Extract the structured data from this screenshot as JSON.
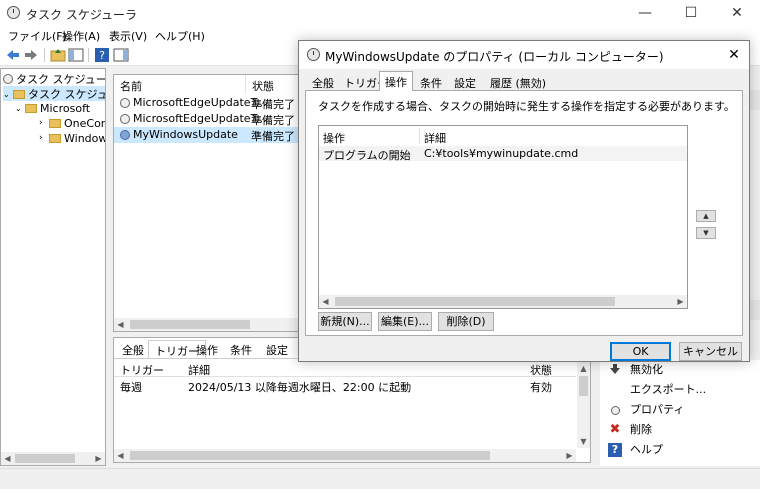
{
  "main_window": {
    "title": "タスク スケジューラ",
    "controls": {
      "minimize": "—",
      "maximize": "☐",
      "close": "✕"
    }
  },
  "menu": [
    "ファイル(F)",
    "操作(A)",
    "表示(V)",
    "ヘルプ(H)"
  ],
  "tree": {
    "root": "タスク スケジューラ (ロ",
    "library": "タスク スケジューラ ラ",
    "microsoft": "Microsoft",
    "children": [
      "OneCore",
      "Windows"
    ]
  },
  "task_list": {
    "headers": {
      "name": "名前",
      "status": "状態"
    },
    "rows": [
      {
        "name": "MicrosoftEdgeUpdateT...",
        "status": "準備完了"
      },
      {
        "name": "MicrosoftEdgeUpdateT...",
        "status": "準備完了"
      },
      {
        "name": "MyWindowsUpdate",
        "status": "準備完了"
      }
    ]
  },
  "detail": {
    "tabs": [
      "全般",
      "トリガー",
      "操作",
      "条件",
      "設定"
    ],
    "active_tab": "トリガー",
    "headers": {
      "trigger": "トリガー",
      "detail": "詳細",
      "status": "状態"
    },
    "rows": [
      {
        "trigger": "毎週",
        "detail": "2024/05/13 以降毎週水曜日、22:00 に起動",
        "status": "有効"
      }
    ]
  },
  "actions_panel": {
    "items": [
      {
        "label": "無効化",
        "icon": "disable-arrow-icon"
      },
      {
        "label": "エクスポート...",
        "icon": "blank"
      },
      {
        "label": "プロパティ",
        "icon": "properties-icon"
      },
      {
        "label": "削除",
        "icon": "delete-x-icon",
        "color": "#c42b1c"
      },
      {
        "label": "ヘルプ",
        "icon": "help-icon"
      }
    ]
  },
  "dialog": {
    "title": "MyWindowsUpdate のプロパティ (ローカル コンピューター)",
    "close": "✕",
    "tabs": [
      "全般",
      "トリガー",
      "操作",
      "条件",
      "設定",
      "履歴 (無効)"
    ],
    "active_tab": "操作",
    "description": "タスクを作成する場合、タスクの開始時に発生する操作を指定する必要があります。",
    "list_headers": {
      "action": "操作",
      "detail": "詳細"
    },
    "list_rows": [
      {
        "action": "プログラムの開始",
        "detail": "C:¥tools¥mywinupdate.cmd"
      }
    ],
    "buttons": {
      "new": "新規(N)...",
      "edit": "編集(E)...",
      "delete": "削除(D)"
    },
    "ok": "OK",
    "cancel": "キャンセル"
  },
  "colors": {
    "accent": "#0078d7",
    "selection": "#cce8ff",
    "folder": "#e8c15c"
  }
}
